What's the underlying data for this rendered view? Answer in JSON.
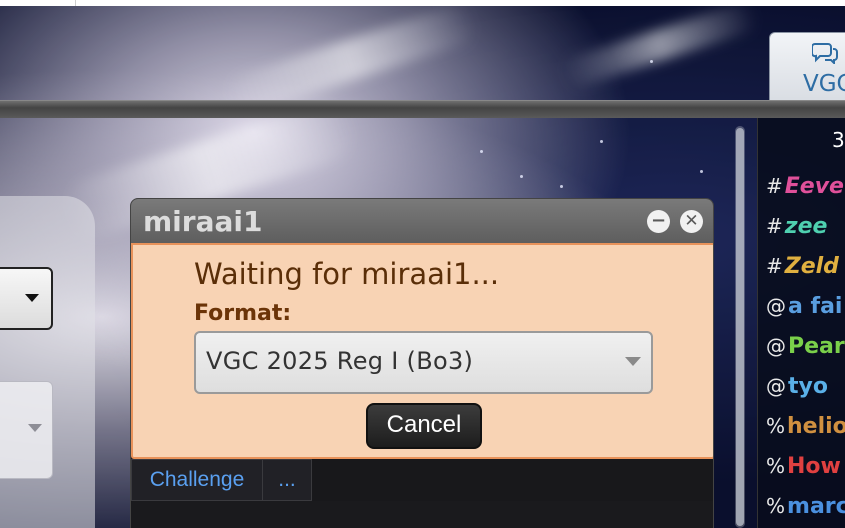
{
  "room_tab": {
    "icon": "chat-bubbles-icon",
    "label": "VGC"
  },
  "userlist": {
    "count": "3",
    "users": [
      {
        "rank": "#",
        "name": "Eeve",
        "color": "#e0509a",
        "italic": true
      },
      {
        "rank": "#",
        "name": "zee",
        "color": "#4fd0b0",
        "italic": true
      },
      {
        "rank": "#",
        "name": "Zeld",
        "color": "#e0b040",
        "italic": true
      },
      {
        "rank": "@",
        "name": "a fai",
        "color": "#5a9ee0",
        "italic": false
      },
      {
        "rank": "@",
        "name": "Pear",
        "color": "#7ad04a",
        "italic": false
      },
      {
        "rank": "@",
        "name": "tyo",
        "color": "#5ab0e8",
        "italic": false
      },
      {
        "rank": "%",
        "name": "helio",
        "color": "#d09040",
        "italic": false
      },
      {
        "rank": "%",
        "name": "How",
        "color": "#e04040",
        "italic": false
      },
      {
        "rank": "%",
        "name": "marc",
        "color": "#4a90e0",
        "italic": false
      }
    ]
  },
  "dialog": {
    "title": "miraai1",
    "minimize_icon": "minus-icon",
    "minimize_glyph": "−",
    "close_icon": "close-icon",
    "close_glyph": "✕",
    "waiting_text": "Waiting for miraai1...",
    "format_label": "Format:",
    "format_value": "VGC 2025 Reg I (Bo3)",
    "cancel_label": "Cancel",
    "tabs": [
      "Challenge",
      "..."
    ]
  },
  "colors": {
    "challenge_bg": "#f8d3b4",
    "challenge_border": "#e8925a",
    "link_blue": "#5aa0f0"
  }
}
